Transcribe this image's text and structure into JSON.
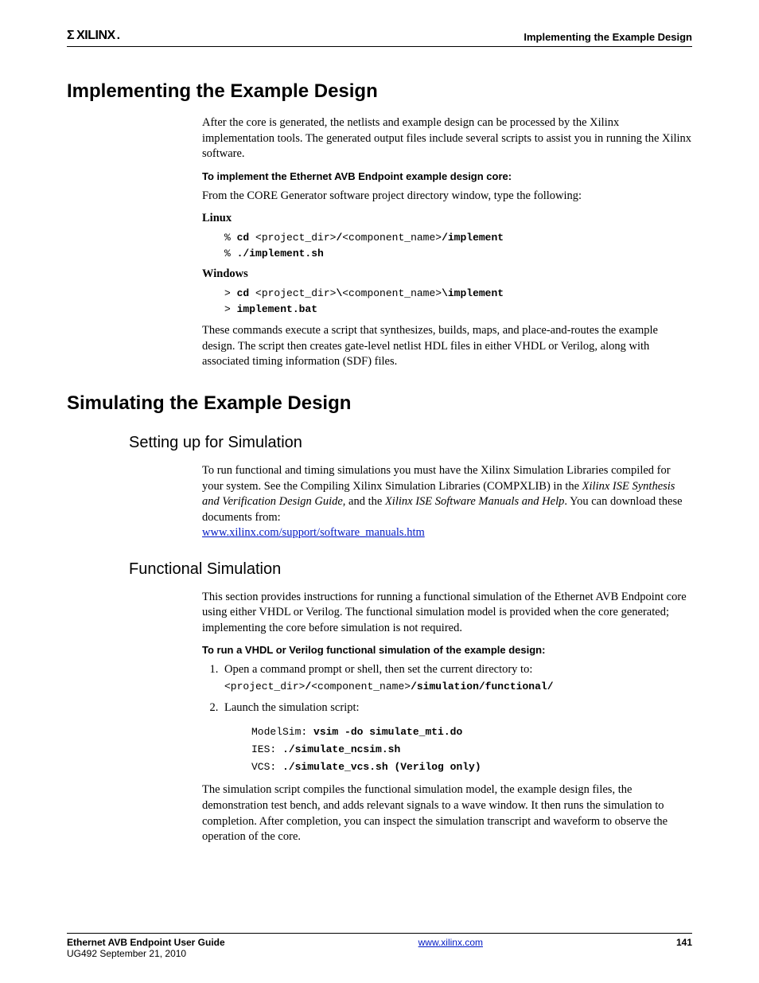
{
  "header": {
    "logo_text": "XILINX",
    "right": "Implementing the Example Design"
  },
  "h1_a": "Implementing the Example Design",
  "p1": "After the core is generated, the netlists and example design can be processed by the Xilinx implementation tools. The generated output files include several scripts to assist you in running the Xilinx software.",
  "t1": "To implement the Ethernet AVB Endpoint example design core:",
  "p2": "From the CORE Generator software project directory window, type the following:",
  "linux_label": "Linux",
  "linux_code": "% cd <project_dir>/<component_name>/implement\n% ./implement.sh",
  "win_label": "Windows",
  "win_code": "> cd <project_dir>\\<component_name>\\implement\n> implement.bat",
  "p3": "These commands execute a script that synthesizes, builds, maps, and place-and-routes the example design. The script then creates gate-level netlist HDL files in either VHDL or Verilog, along with associated timing information (SDF) files.",
  "h1_b": "Simulating the Example Design",
  "h2_a": "Setting up for Simulation",
  "p4a": "To run functional and timing simulations you must have the Xilinx Simulation Libraries compiled for your system. See the Compiling Xilinx Simulation Libraries (COMPXLIB) in the ",
  "p4b": "Xilinx ISE Synthesis and Verification Design Guide",
  "p4c": ", and the ",
  "p4d": "Xilinx ISE Software Manuals and Help",
  "p4e": ". You can download these documents from:",
  "link1": "www.xilinx.com/support/software_manuals.htm",
  "h2_b": "Functional Simulation",
  "p5": "This section provides instructions for running a functional simulation of the Ethernet AVB Endpoint core using either VHDL or Verilog. The functional simulation model is provided when the core generated; implementing the core before simulation is not required.",
  "t2": "To run a VHDL or Verilog functional simulation of the example design:",
  "li1a": "Open a command prompt or shell, then set the current directory to:",
  "li1b": "<project_dir>/<component_name>/simulation/functional/",
  "li2": "Launch the simulation script:",
  "sim_code": "ModelSim: vsim -do simulate_mti.do\nIES: ./simulate_ncsim.sh\nVCS: ./simulate_vcs.sh (Verilog only)",
  "p6": "The simulation script compiles the functional simulation model, the example design files, the demonstration test bench, and adds relevant signals to a wave window. It then runs the simulation to completion. After completion, you can inspect the simulation transcript and waveform to observe the operation of the core.",
  "footer": {
    "title": "Ethernet AVB Endpoint User Guide",
    "sub": "UG492 September 21, 2010",
    "url": "www.xilinx.com",
    "page": "141"
  }
}
